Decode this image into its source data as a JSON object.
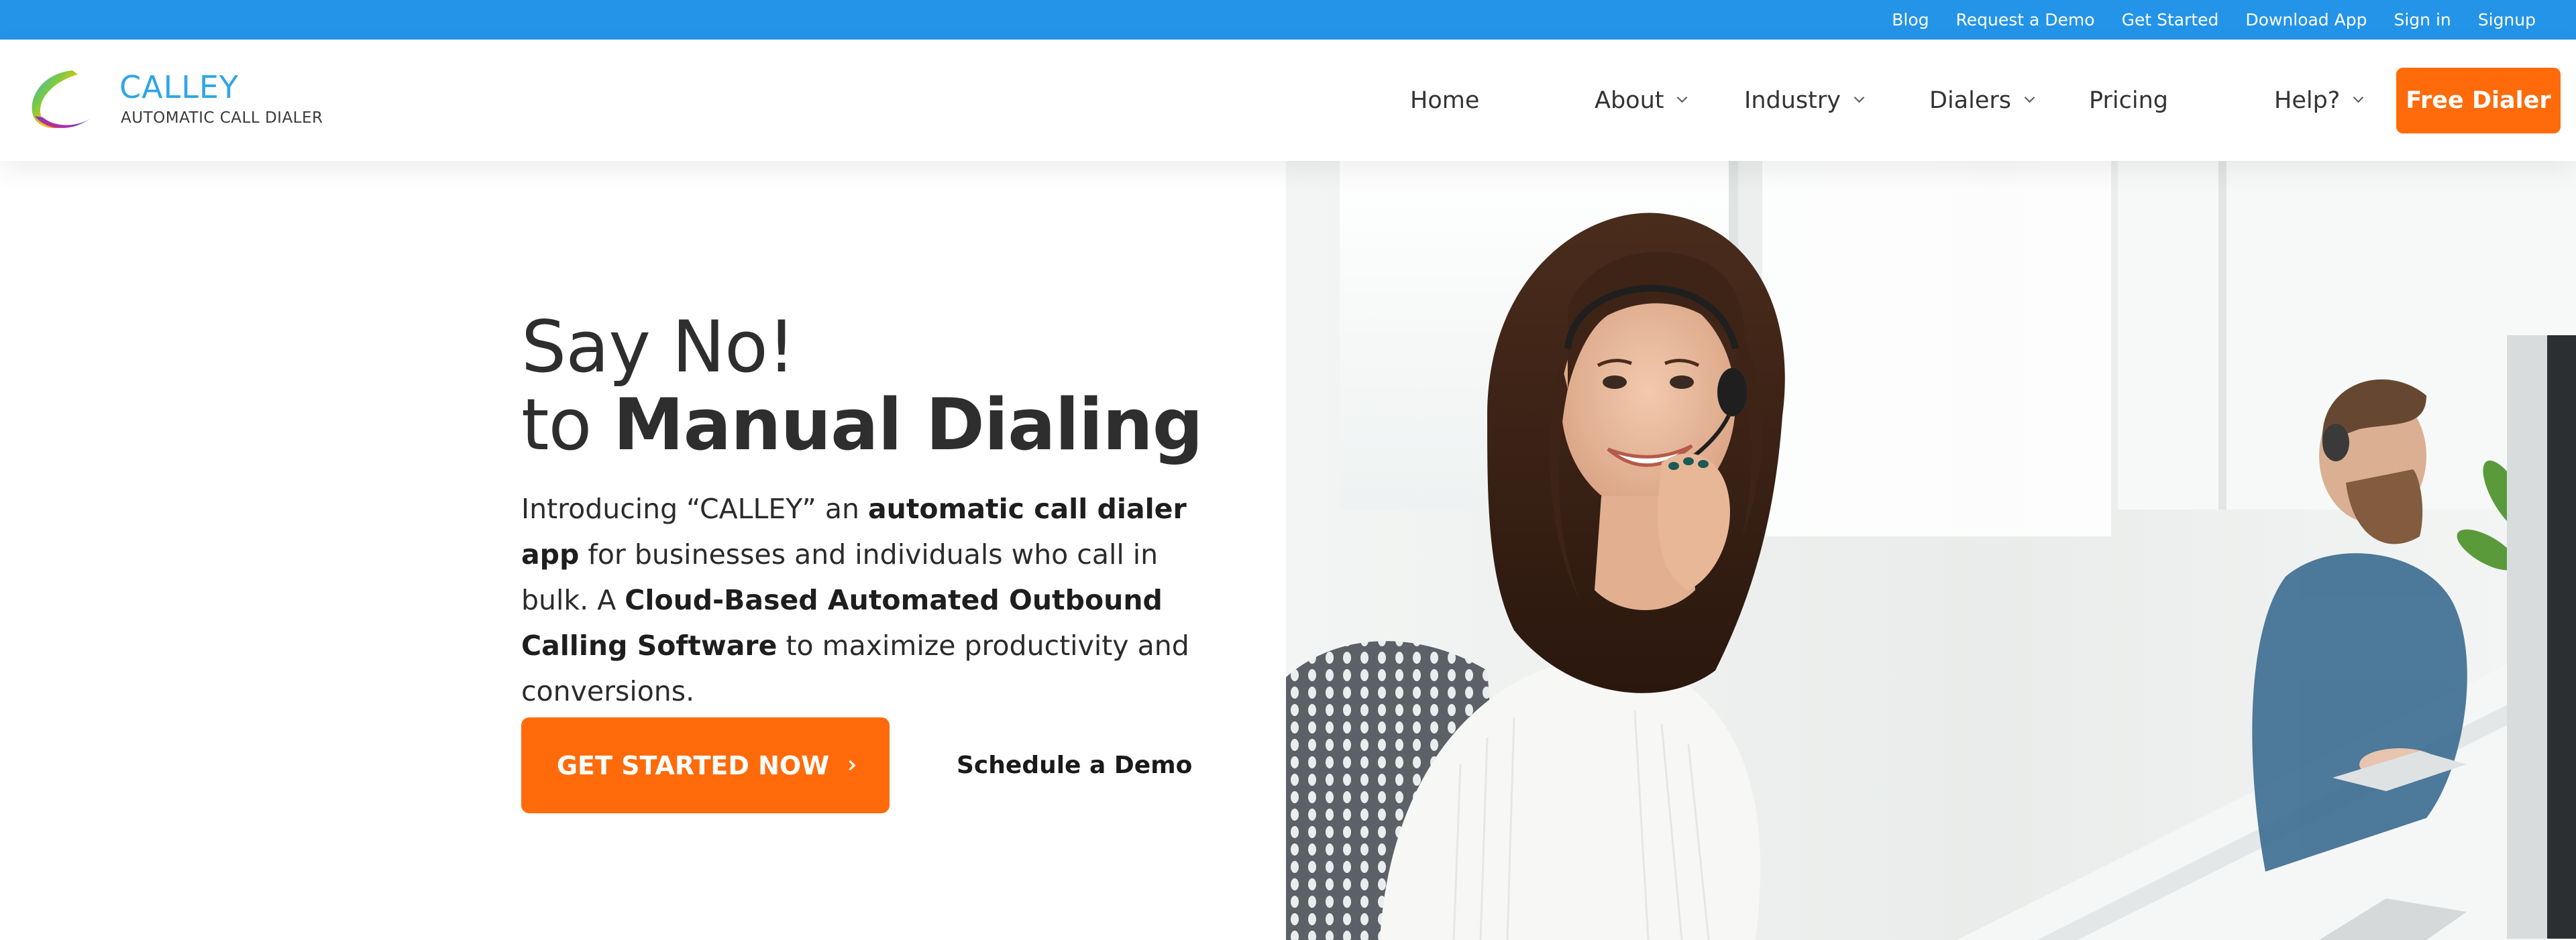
{
  "topbar": {
    "links": [
      "Blog",
      "Request a Demo",
      "Get Started",
      "Download App",
      "Sign in",
      "Signup"
    ]
  },
  "header": {
    "logo": {
      "name": "CALLEY",
      "tagline": "AUTOMATIC CALL DIALER"
    },
    "nav": {
      "home": "Home",
      "about": "About",
      "industry": "Industry",
      "dialers": "Dialers",
      "pricing": "Pricing",
      "help": "Help?"
    },
    "cta_label": "Free Dialer"
  },
  "hero": {
    "headline_line1": "Say No!",
    "headline_to": "to",
    "headline_strong": "Manual Dialing",
    "intro": {
      "t1": "Introducing “CALLEY” an ",
      "b1": "automatic call dialer app",
      "t2": " for businesses and individuals who call in bulk. A ",
      "b2": "Cloud-Based Automated Outbound Calling Software",
      "t3": " to maximize productivity and conversions."
    },
    "primary_button": "GET STARTED NOW",
    "secondary_button": "Schedule a Demo"
  },
  "colors": {
    "topbar": "#2394e8",
    "accent": "#ff6b0a",
    "brand_blue": "#2fa6e6",
    "text": "#2e2e2e"
  },
  "icons": [
    "calley-logo-mark",
    "chevron-down-icon",
    "chevron-right-icon"
  ]
}
